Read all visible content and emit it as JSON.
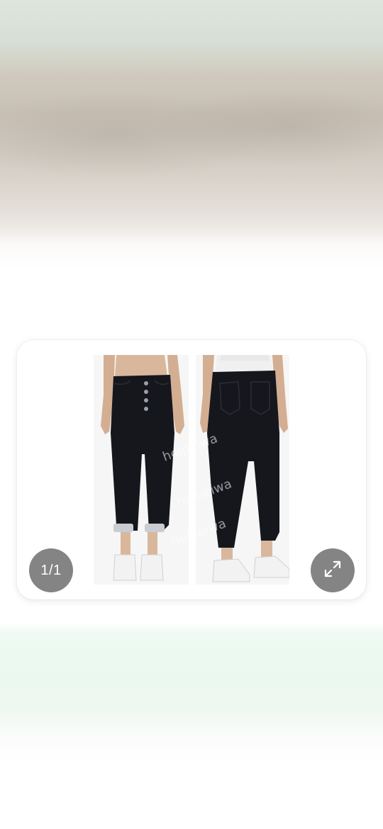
{
  "viewer": {
    "counter_text": "1/1",
    "image": {
      "subject": "black high-waist skinny jeans, front and back view",
      "watermark": "heipeiwa"
    }
  },
  "icons": {
    "expand": "expand-arrows-icon"
  },
  "colors": {
    "badge_bg": "#6e6e6e",
    "card_bg": "#ffffff",
    "denim": "#15171d"
  }
}
